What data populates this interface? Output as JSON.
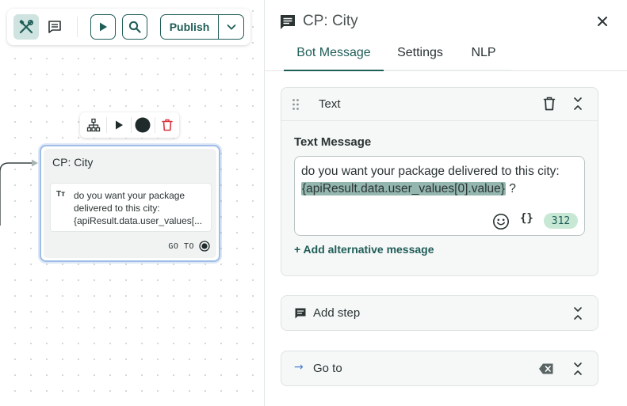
{
  "toolbar": {
    "tools_icon": "tools-icon",
    "notes_icon": "notes-icon",
    "play_icon": "play-icon",
    "search_icon": "search-icon",
    "publish_label": "Publish",
    "publish_caret_icon": "chevron-down-icon"
  },
  "node_toolbar": {
    "items": [
      "hierarchy-icon",
      "play-icon",
      "record-icon",
      "trash-icon"
    ]
  },
  "node": {
    "title": "CP: City",
    "message_icon": "Tт",
    "message_preview": "do you want your package delivered to this city: {apiResult.data.user_values[...",
    "goto_label": "GO TO"
  },
  "panel": {
    "title": "CP: City",
    "title_icon": "message-square-icon",
    "close_icon": "close-icon",
    "tabs": [
      {
        "label": "Bot Message",
        "active": true
      },
      {
        "label": "Settings",
        "active": false
      },
      {
        "label": "NLP",
        "active": false
      }
    ],
    "text_section": {
      "label": "Text",
      "field_label": "Text Message",
      "message_before": "do you want your package delivered to this city: ",
      "message_variable": "{apiResult.data.user_values[0].value}",
      "message_after": " ?",
      "char_count": "312",
      "add_alternative": "+ Add alternative message"
    },
    "add_step": {
      "label": "Add step"
    },
    "go_to": {
      "label": "Go to",
      "arrow": "→"
    }
  },
  "colors": {
    "accent": "#1f5d57",
    "selection": "#9fbde6",
    "variable_highlight": "#93b7ae",
    "count_badge": "#c7e8d4",
    "delete": "#d9363e"
  }
}
